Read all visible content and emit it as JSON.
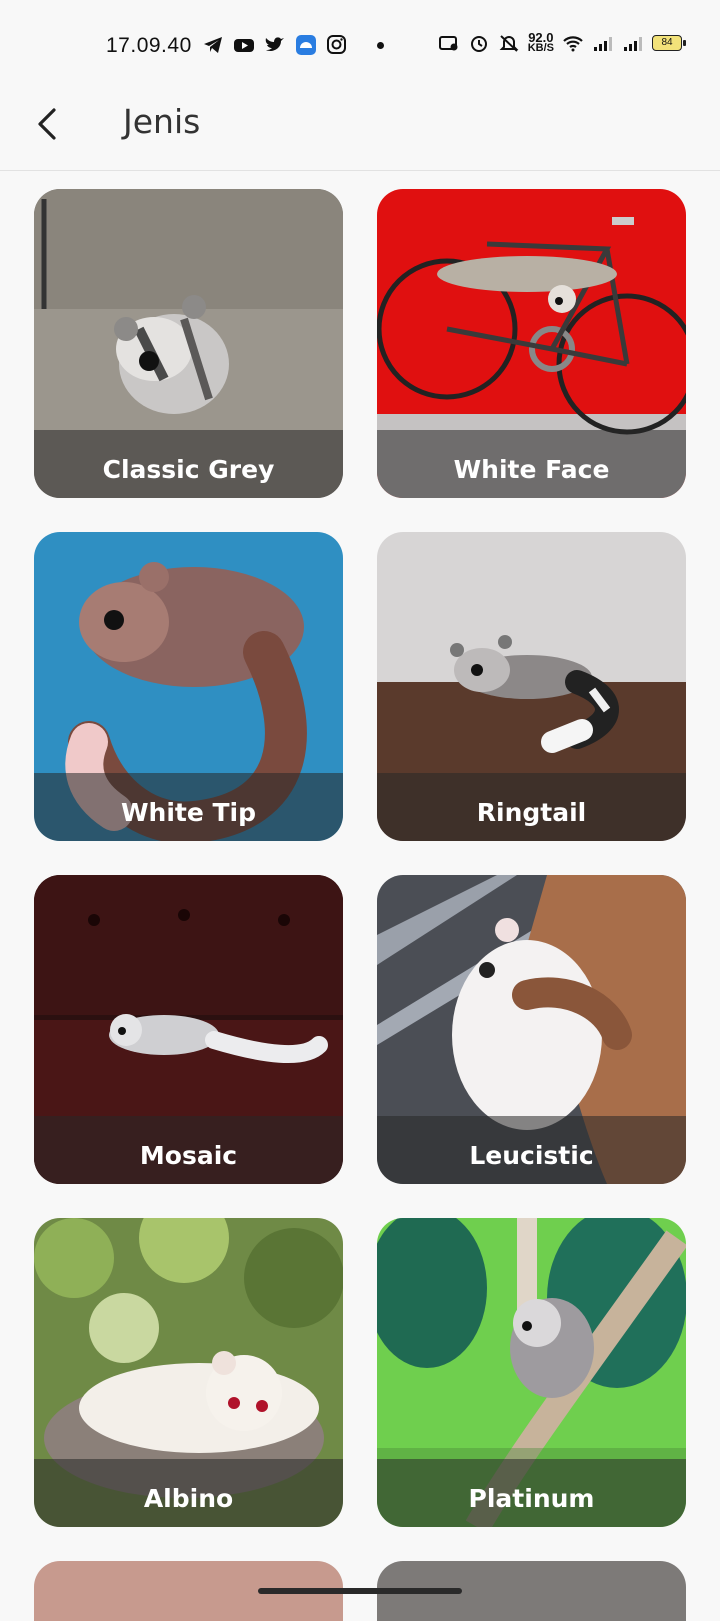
{
  "status_bar": {
    "time": "17.09.40",
    "net_speed_value": "92.0",
    "net_speed_unit": "KB/S",
    "battery": "84"
  },
  "app_bar": {
    "title": "Jenis"
  },
  "cards": [
    {
      "label": "Classic Grey"
    },
    {
      "label": "White Face"
    },
    {
      "label": "White Tip"
    },
    {
      "label": "Ringtail"
    },
    {
      "label": "Mosaic"
    },
    {
      "label": "Leucistic"
    },
    {
      "label": "Albino"
    },
    {
      "label": "Platinum"
    }
  ]
}
